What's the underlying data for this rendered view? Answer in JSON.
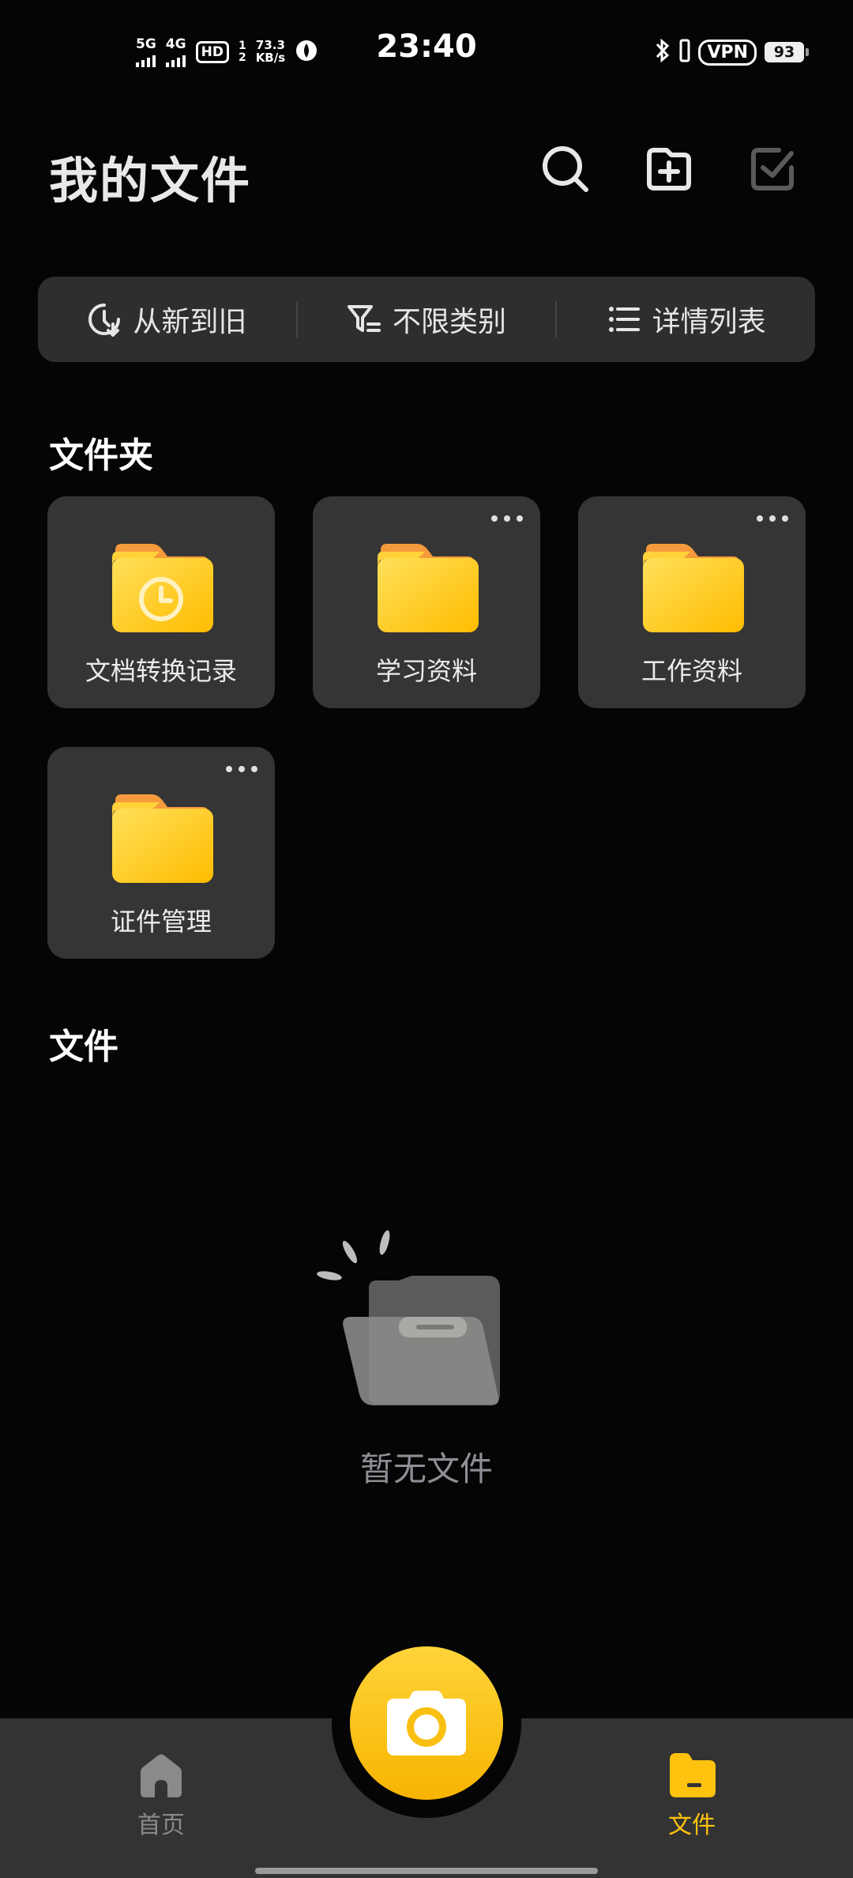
{
  "status_bar": {
    "network_5g": "5G",
    "network_4g": "4G",
    "hd": "HD",
    "hd_sub_1": "1",
    "hd_sub_2": "2",
    "speed_value": "73.3",
    "speed_unit": "KB/s",
    "time": "23:40",
    "vpn": "VPN",
    "battery": "93"
  },
  "header": {
    "title": "我的文件",
    "icons": [
      "search-icon",
      "add-folder-icon",
      "select-icon"
    ]
  },
  "filter_bar": {
    "sort_label": "从新到旧",
    "category_label": "不限类别",
    "view_label": "详情列表"
  },
  "folders_section": {
    "title": "文件夹",
    "items": [
      {
        "name": "文档转换记录",
        "icon": "history-folder-icon",
        "has_more": false
      },
      {
        "name": "学习资料",
        "icon": "folder-icon",
        "has_more": true
      },
      {
        "name": "工作资料",
        "icon": "folder-icon",
        "has_more": true
      },
      {
        "name": "证件管理",
        "icon": "folder-icon",
        "has_more": true
      }
    ]
  },
  "files_section": {
    "title": "文件",
    "empty_text": "暂无文件"
  },
  "bottom_nav": {
    "home_label": "首页",
    "files_label": "文件",
    "active": "files"
  },
  "colors": {
    "accent": "#FFC20E",
    "background": "#050505",
    "card": "#353535",
    "inactive_nav": "#8a8a8a"
  }
}
